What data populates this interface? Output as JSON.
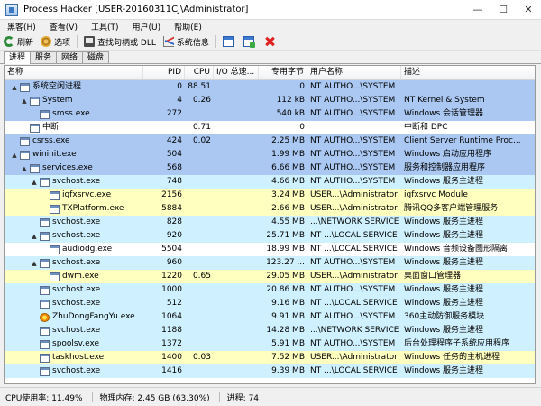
{
  "window": {
    "title": "Process Hacker [USER-20160311CJ\\Administrator]"
  },
  "window_controls": {
    "minimize": "—",
    "maximize": "☐",
    "close": "✕"
  },
  "menu": [
    "黑客(H)",
    "查看(V)",
    "工具(T)",
    "用户(U)",
    "帮助(E)"
  ],
  "toolbar": {
    "refresh": "刷新",
    "options": "选项",
    "find": "查找句柄或 DLL",
    "sysinfo": "系统信息"
  },
  "tabs": [
    "进程",
    "服务",
    "网络",
    "磁盘"
  ],
  "columns": {
    "name": "名称",
    "pid": "PID",
    "cpu": "CPU",
    "io": "I/O 总速...",
    "private": "专用字节",
    "user": "用户名称",
    "desc": "描述"
  },
  "colors": {
    "system": "#aac8f2",
    "service": "#cff0fe",
    "own": "#ffffbf",
    "selected_text": "#000000"
  },
  "rows": [
    {
      "name": "系统空闲进程",
      "pid": "0",
      "cpu": "88.51",
      "io": "",
      "private": "0",
      "user": "NT AUTHO...\\SYSTEM",
      "desc": "",
      "indent": 0,
      "expander": "▲",
      "type": "system"
    },
    {
      "name": "System",
      "pid": "4",
      "cpu": "0.26",
      "io": "",
      "private": "112 kB",
      "user": "NT AUTHO...\\SYSTEM",
      "desc": "NT Kernel & System",
      "indent": 1,
      "expander": "▲",
      "type": "system"
    },
    {
      "name": "smss.exe",
      "pid": "272",
      "cpu": "",
      "io": "",
      "private": "540 kB",
      "user": "NT AUTHO...\\SYSTEM",
      "desc": "Windows 会话管理器",
      "indent": 2,
      "expander": "",
      "type": "system"
    },
    {
      "name": "中断",
      "pid": "",
      "cpu": "0.71",
      "io": "",
      "private": "0",
      "user": "",
      "desc": "中断和 DPC",
      "indent": 1,
      "expander": "",
      "type": "plain"
    },
    {
      "name": "csrss.exe",
      "pid": "424",
      "cpu": "0.02",
      "io": "",
      "private": "2.25 MB",
      "user": "NT AUTHO...\\SYSTEM",
      "desc": "Client Server Runtime Proc...",
      "indent": 0,
      "expander": "",
      "type": "system"
    },
    {
      "name": "wininit.exe",
      "pid": "504",
      "cpu": "",
      "io": "",
      "private": "1.99 MB",
      "user": "NT AUTHO...\\SYSTEM",
      "desc": "Windows 启动应用程序",
      "indent": 0,
      "expander": "▲",
      "type": "system"
    },
    {
      "name": "services.exe",
      "pid": "568",
      "cpu": "",
      "io": "",
      "private": "6.66 MB",
      "user": "NT AUTHO...\\SYSTEM",
      "desc": "服务和控制器应用程序",
      "indent": 1,
      "expander": "▲",
      "type": "system"
    },
    {
      "name": "svchost.exe",
      "pid": "748",
      "cpu": "",
      "io": "",
      "private": "4.66 MB",
      "user": "NT AUTHO...\\SYSTEM",
      "desc": "Windows 服务主进程",
      "indent": 2,
      "expander": "▲",
      "type": "service"
    },
    {
      "name": "igfxsrvc.exe",
      "pid": "2156",
      "cpu": "",
      "io": "",
      "private": "3.24 MB",
      "user": "USER...\\Administrator",
      "desc": "igfxsrvc Module",
      "indent": 3,
      "expander": "",
      "type": "own"
    },
    {
      "name": "TXPlatform.exe",
      "pid": "5884",
      "cpu": "",
      "io": "",
      "private": "2.66 MB",
      "user": "USER...\\Administrator",
      "desc": "腾讯QQ多客户端管理服务",
      "indent": 3,
      "expander": "",
      "type": "own"
    },
    {
      "name": "svchost.exe",
      "pid": "828",
      "cpu": "",
      "io": "",
      "private": "4.55 MB",
      "user": "...\\NETWORK SERVICE",
      "desc": "Windows 服务主进程",
      "indent": 2,
      "expander": "",
      "type": "service"
    },
    {
      "name": "svchost.exe",
      "pid": "920",
      "cpu": "",
      "io": "",
      "private": "25.71 MB",
      "user": "NT ...\\LOCAL SERVICE",
      "desc": "Windows 服务主进程",
      "indent": 2,
      "expander": "▲",
      "type": "service"
    },
    {
      "name": "audiodg.exe",
      "pid": "5504",
      "cpu": "",
      "io": "",
      "private": "18.99 MB",
      "user": "NT ...\\LOCAL SERVICE",
      "desc": "Windows 音频设备图形隔离",
      "indent": 3,
      "expander": "",
      "type": "plain"
    },
    {
      "name": "svchost.exe",
      "pid": "960",
      "cpu": "",
      "io": "",
      "private": "123.27 ...",
      "user": "NT AUTHO...\\SYSTEM",
      "desc": "Windows 服务主进程",
      "indent": 2,
      "expander": "▲",
      "type": "service"
    },
    {
      "name": "dwm.exe",
      "pid": "1220",
      "cpu": "0.65",
      "io": "",
      "private": "29.05 MB",
      "user": "USER...\\Administrator",
      "desc": "桌面窗口管理器",
      "indent": 3,
      "expander": "",
      "type": "own"
    },
    {
      "name": "svchost.exe",
      "pid": "1000",
      "cpu": "",
      "io": "",
      "private": "20.86 MB",
      "user": "NT AUTHO...\\SYSTEM",
      "desc": "Windows 服务主进程",
      "indent": 2,
      "expander": "",
      "type": "service"
    },
    {
      "name": "svchost.exe",
      "pid": "512",
      "cpu": "",
      "io": "",
      "private": "9.16 MB",
      "user": "NT ...\\LOCAL SERVICE",
      "desc": "Windows 服务主进程",
      "indent": 2,
      "expander": "",
      "type": "service"
    },
    {
      "name": "ZhuDongFangYu.exe",
      "pid": "1064",
      "cpu": "",
      "io": "",
      "private": "9.91 MB",
      "user": "NT AUTHO...\\SYSTEM",
      "desc": "360主动防御服务模块",
      "indent": 2,
      "expander": "",
      "type": "service",
      "special_icon": true
    },
    {
      "name": "svchost.exe",
      "pid": "1188",
      "cpu": "",
      "io": "",
      "private": "14.28 MB",
      "user": "...\\NETWORK SERVICE",
      "desc": "Windows 服务主进程",
      "indent": 2,
      "expander": "",
      "type": "service"
    },
    {
      "name": "spoolsv.exe",
      "pid": "1372",
      "cpu": "",
      "io": "",
      "private": "5.91 MB",
      "user": "NT AUTHO...\\SYSTEM",
      "desc": "后台处理程序子系统应用程序",
      "indent": 2,
      "expander": "",
      "type": "service"
    },
    {
      "name": "taskhost.exe",
      "pid": "1400",
      "cpu": "0.03",
      "io": "",
      "private": "7.52 MB",
      "user": "USER...\\Administrator",
      "desc": "Windows 任务的主机进程",
      "indent": 2,
      "expander": "",
      "type": "own"
    },
    {
      "name": "svchost.exe",
      "pid": "1416",
      "cpu": "",
      "io": "",
      "private": "9.39 MB",
      "user": "NT ...\\LOCAL SERVICE",
      "desc": "Windows 服务主进程",
      "indent": 2,
      "expander": "",
      "type": "service"
    }
  ],
  "status": {
    "cpu": "CPU使用率: 11.49%",
    "mem": "物理内存: 2.45 GB (63.30%)",
    "proc": "进程: 74"
  }
}
